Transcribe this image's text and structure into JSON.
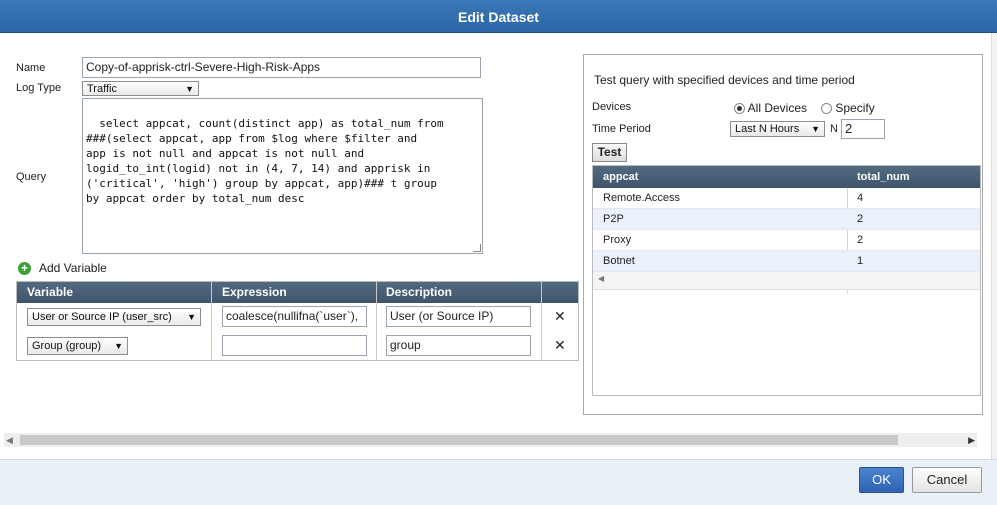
{
  "dialog": {
    "title": "Edit Dataset"
  },
  "form": {
    "name_label": "Name",
    "name_value": "Copy-of-apprisk-ctrl-Severe-High-Risk-Apps",
    "logtype_label": "Log Type",
    "logtype_value": "Traffic",
    "query_label": "Query",
    "query_value": "select appcat, count(distinct app) as total_num from\n###(select appcat, app from $log where $filter and\napp is not null and appcat is not null and\nlogid_to_int(logid) not in (4, 7, 14) and apprisk in\n('critical', 'high') group by appcat, app)### t group\nby appcat order by total_num desc"
  },
  "variables": {
    "add_label": "Add Variable",
    "headers": {
      "variable": "Variable",
      "expression": "Expression",
      "description": "Description"
    },
    "rows": [
      {
        "variable": "User or Source IP (user_src)",
        "expression": "coalesce(nullifna(`user`),",
        "description": "User (or Source IP)"
      },
      {
        "variable": "Group (group)",
        "expression": "",
        "description": "group"
      }
    ],
    "delete_glyph": "✕"
  },
  "test_panel": {
    "heading": "Test query with specified devices and time period",
    "devices_label": "Devices",
    "all_devices": "All Devices",
    "specify": "Specify",
    "time_period_label": "Time Period",
    "time_period_value": "Last N Hours",
    "n_label": "N",
    "n_value": "2",
    "test_button": "Test",
    "results": {
      "headers": [
        "appcat",
        "total_num"
      ],
      "rows": [
        {
          "appcat": "Remote.Access",
          "total_num": "4"
        },
        {
          "appcat": "P2P",
          "total_num": "2"
        },
        {
          "appcat": "Proxy",
          "total_num": "2"
        },
        {
          "appcat": "Botnet",
          "total_num": "1"
        }
      ]
    }
  },
  "footer": {
    "ok": "OK",
    "cancel": "Cancel"
  },
  "icons": {
    "add": "plus-circle-icon",
    "delete": "close-icon",
    "dropdown": "chevron-down-icon",
    "scroll_left": "arrow-left-icon",
    "scroll_right": "arrow-right-icon"
  }
}
